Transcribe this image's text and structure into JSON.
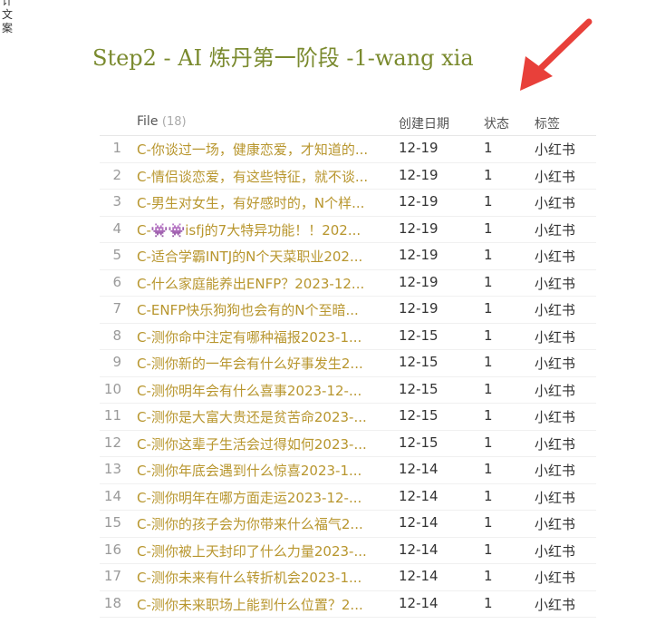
{
  "sidebar_fragment": "计文案",
  "page_title": "Step2 - AI 炼丹第一阶段 -1-wang xia",
  "colors": {
    "title": "#7a8a2e",
    "file_link": "#b8962e",
    "arrow": "#e8403a"
  },
  "table": {
    "headers": {
      "file": "File",
      "file_count": "(18)",
      "date": "创建日期",
      "status": "状态",
      "tag": "标签"
    },
    "rows": [
      {
        "num": "1",
        "file": "C-你谈过一场，健康恋爱，才知道的...",
        "date": "12-19",
        "status": "1",
        "tag": "小红书"
      },
      {
        "num": "2",
        "file": "C-情侣谈恋爱，有这些特征，就不谈...",
        "date": "12-19",
        "status": "1",
        "tag": "小红书"
      },
      {
        "num": "3",
        "file": "C-男生对女生，有好感时的，N个样...",
        "date": "12-19",
        "status": "1",
        "tag": "小红书"
      },
      {
        "num": "4",
        "file": "C-👾👾isfj的7大特异功能！！202...",
        "date": "12-19",
        "status": "1",
        "tag": "小红书"
      },
      {
        "num": "5",
        "file": "C-适合学霸INTJ的N个天菜职业202...",
        "date": "12-19",
        "status": "1",
        "tag": "小红书"
      },
      {
        "num": "6",
        "file": "C-什么家庭能养出ENFP？2023-12...",
        "date": "12-19",
        "status": "1",
        "tag": "小红书"
      },
      {
        "num": "7",
        "file": "C-ENFP快乐狗狗也会有的N个至暗...",
        "date": "12-19",
        "status": "1",
        "tag": "小红书"
      },
      {
        "num": "8",
        "file": "C-测你命中注定有哪种福报2023-1...",
        "date": "12-15",
        "status": "1",
        "tag": "小红书"
      },
      {
        "num": "9",
        "file": "C-测你新的一年会有什么好事发生2...",
        "date": "12-15",
        "status": "1",
        "tag": "小红书"
      },
      {
        "num": "10",
        "file": "C-测你明年会有什么喜事2023-12-...",
        "date": "12-15",
        "status": "1",
        "tag": "小红书"
      },
      {
        "num": "11",
        "file": "C-测你是大富大贵还是贫苦命2023-...",
        "date": "12-15",
        "status": "1",
        "tag": "小红书"
      },
      {
        "num": "12",
        "file": "C-测你这辈子生活会过得如何2023-...",
        "date": "12-15",
        "status": "1",
        "tag": "小红书"
      },
      {
        "num": "13",
        "file": "C-测你年底会遇到什么惊喜2023-1...",
        "date": "12-14",
        "status": "1",
        "tag": "小红书"
      },
      {
        "num": "14",
        "file": "C-测你明年在哪方面走运2023-12-...",
        "date": "12-14",
        "status": "1",
        "tag": "小红书"
      },
      {
        "num": "15",
        "file": "C-测你的孩子会为你带来什么福气2...",
        "date": "12-14",
        "status": "1",
        "tag": "小红书"
      },
      {
        "num": "16",
        "file": "C-测你被上天封印了什么力量2023-...",
        "date": "12-14",
        "status": "1",
        "tag": "小红书"
      },
      {
        "num": "17",
        "file": "C-测你未来有什么转折机会2023-1...",
        "date": "12-14",
        "status": "1",
        "tag": "小红书"
      },
      {
        "num": "18",
        "file": "C-测你未来职场上能到什么位置？2...",
        "date": "12-14",
        "status": "1",
        "tag": "小红书"
      }
    ]
  }
}
